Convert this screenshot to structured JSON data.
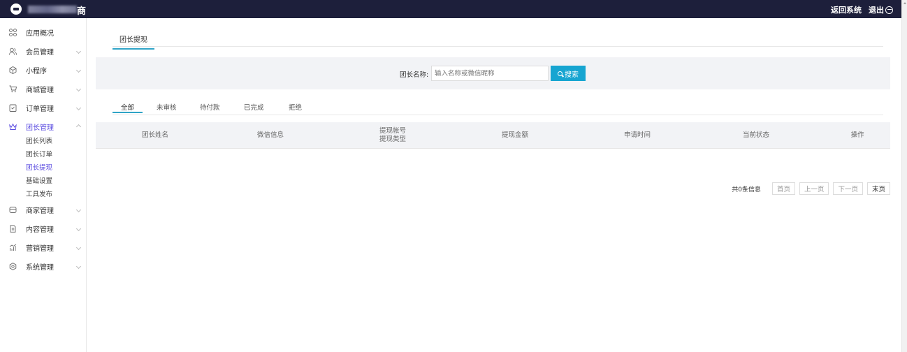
{
  "header": {
    "brand_suffix": "商",
    "return_label": "返回系统",
    "logout_label": "退出"
  },
  "sidebar": {
    "items": [
      {
        "label": "应用概况",
        "icon": "grid-icon"
      },
      {
        "label": "会员管理",
        "icon": "users-icon"
      },
      {
        "label": "小程序",
        "icon": "hexagon-icon"
      },
      {
        "label": "商城管理",
        "icon": "cart-icon"
      },
      {
        "label": "订单管理",
        "icon": "clipboard-icon"
      },
      {
        "label": "团长管理",
        "icon": "crown-icon"
      },
      {
        "label": "商家管理",
        "icon": "store-icon"
      },
      {
        "label": "内容管理",
        "icon": "document-icon"
      },
      {
        "label": "营销管理",
        "icon": "chart-icon"
      },
      {
        "label": "系统管理",
        "icon": "settings-icon"
      }
    ],
    "submenu": [
      "团长列表",
      "团长订单",
      "团长提现",
      "基础设置",
      "工具发布"
    ]
  },
  "page": {
    "tab": "团长提现"
  },
  "search": {
    "label": "团长名称:",
    "placeholder": "输入名称或微信昵称",
    "button": "搜索"
  },
  "status_tabs": [
    "全部",
    "未审核",
    "待付款",
    "已完成",
    "拒绝"
  ],
  "table": {
    "columns": [
      "团长姓名",
      "微信信息",
      "提现帐号",
      "提现类型",
      "提现金额",
      "申请时间",
      "当前状态",
      "操作"
    ]
  },
  "pagination": {
    "total": "共0条信息",
    "first": "首页",
    "prev": "上一页",
    "next": "下一页",
    "last": "末页"
  },
  "colors": {
    "topbar": "#1d1f3b",
    "accent": "#17a5d1",
    "active_nav": "#5a4be0"
  }
}
